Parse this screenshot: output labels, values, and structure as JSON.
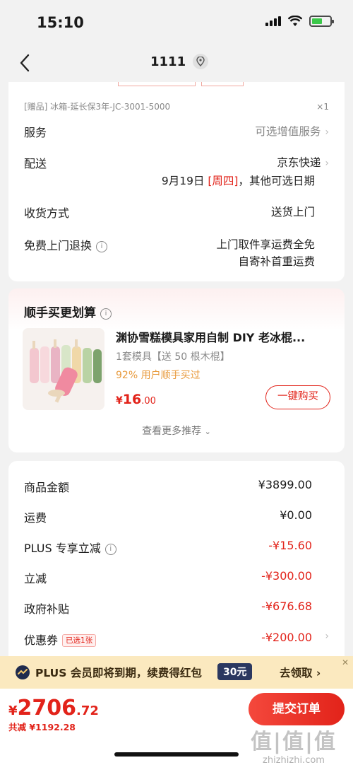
{
  "status": {
    "time": "15:10"
  },
  "nav": {
    "title": "1111"
  },
  "order_info": {
    "gift_line": "[赠品] 冰箱-延长保3年-JC-3001-5000",
    "gift_qty": "×1",
    "service_label": "服务",
    "service_value": "可选增值服务",
    "delivery_label": "配送",
    "delivery_value": "京东快递",
    "delivery_date_prefix": "9月19日 ",
    "delivery_date_day": "[周四]",
    "delivery_date_suffix": "，其他可选日期",
    "receive_label": "收货方式",
    "receive_value": "送货上门",
    "return_label": "免费上门退换",
    "return_value_1": "上门取件享运费全免",
    "return_value_2": "自寄补首重运费"
  },
  "recommend": {
    "title": "顺手买更划算",
    "product_name": "渊协雪糕模具家用自制 DIY 老冰棍...",
    "spec": "1套模具【送 50 根木棍】",
    "rate": "92% 用户顺手买过",
    "price_symbol": "¥",
    "price_int": "16",
    "price_dec": ".00",
    "buy_label": "一键购买",
    "more_label": "查看更多推荐"
  },
  "summary": {
    "rows": [
      {
        "label": "商品金额",
        "value": "¥3899.00",
        "red": false
      },
      {
        "label": "运费",
        "value": "¥0.00",
        "red": false
      },
      {
        "label": "PLUS 专享立减",
        "value": "-¥15.60",
        "red": true
      },
      {
        "label": "立减",
        "value": "-¥300.00",
        "red": true
      },
      {
        "label": "政府补贴",
        "value": "-¥676.68",
        "red": true
      },
      {
        "label": "优惠券",
        "value": "-¥200.00",
        "red": true
      }
    ],
    "coupon_tag": "已选1张"
  },
  "plus_banner": {
    "text": "PLUS 会员即将到期，续费得红包",
    "amount": "30元",
    "action": "去领取 ›"
  },
  "bottom": {
    "yen": "¥",
    "price_int": "2706",
    "price_dec": ".72",
    "saved": "共减 ¥1192.28",
    "submit_label": "提交订单"
  },
  "watermark": {
    "big": "值|值|值",
    "small": "zhizhizhi.com"
  },
  "colors": {
    "accent": "#e2231a",
    "banner": "#fbe9bf",
    "background": "#f2f2f2"
  }
}
